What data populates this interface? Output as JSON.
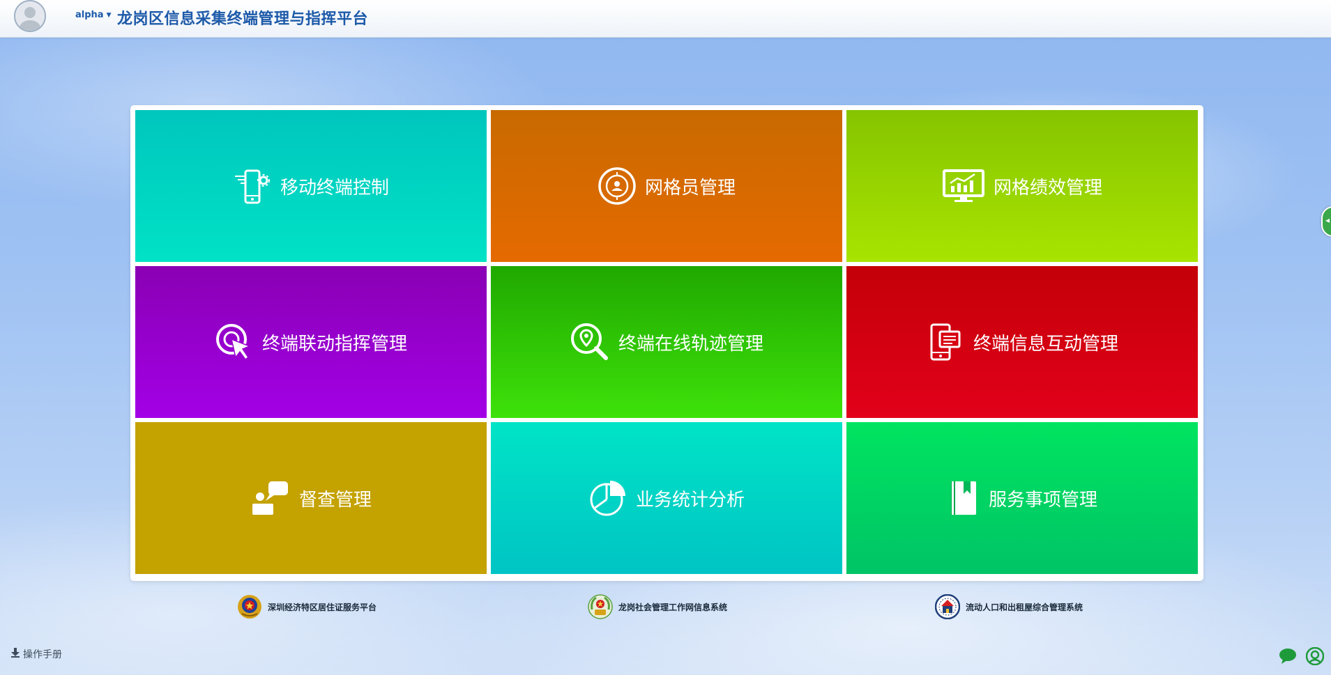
{
  "header": {
    "username": "alpha",
    "title": "龙岗区信息采集终端管理与指挥平台"
  },
  "tiles": [
    {
      "label": "移动终端控制",
      "color_top": "#00c6bd",
      "color_bottom": "#00e2c6",
      "icon": "mobile-gear-icon"
    },
    {
      "label": "网格员管理",
      "color_top": "#c86a00",
      "color_bottom": "#e56a00",
      "icon": "grid-person-icon"
    },
    {
      "label": "网格绩效管理",
      "color_top": "#86c400",
      "color_bottom": "#a8e400",
      "icon": "monitor-chart-icon"
    },
    {
      "label": "终端联动指挥管理",
      "color_top": "#8a00b4",
      "color_bottom": "#a300e6",
      "icon": "target-cursor-icon"
    },
    {
      "label": "终端在线轨迹管理",
      "color_top": "#20a800",
      "color_bottom": "#3ee20a",
      "icon": "location-search-icon"
    },
    {
      "label": "终端信息互动管理",
      "color_top": "#c40008",
      "color_bottom": "#e2001a",
      "icon": "mobile-message-icon"
    },
    {
      "label": "督查管理",
      "color_top": "#c4a200",
      "color_bottom": "#c4a200",
      "icon": "person-speech-icon"
    },
    {
      "label": "业务统计分析",
      "color_top": "#00e4c6",
      "color_bottom": "#00c4c4",
      "icon": "pie-chart-icon"
    },
    {
      "label": "服务事项管理",
      "color_top": "#00e460",
      "color_bottom": "#00c466",
      "icon": "book-bookmark-icon"
    }
  ],
  "systems": [
    {
      "label": "深圳经济特区居住证服务平台",
      "icon": "police-emblem-icon"
    },
    {
      "label": "龙岗社会管理工作网信息系统",
      "icon": "government-emblem-icon"
    },
    {
      "label": "流动人口和出租屋综合管理系统",
      "icon": "housing-emblem-icon"
    }
  ],
  "footer": {
    "manual_label": "操作手册"
  }
}
